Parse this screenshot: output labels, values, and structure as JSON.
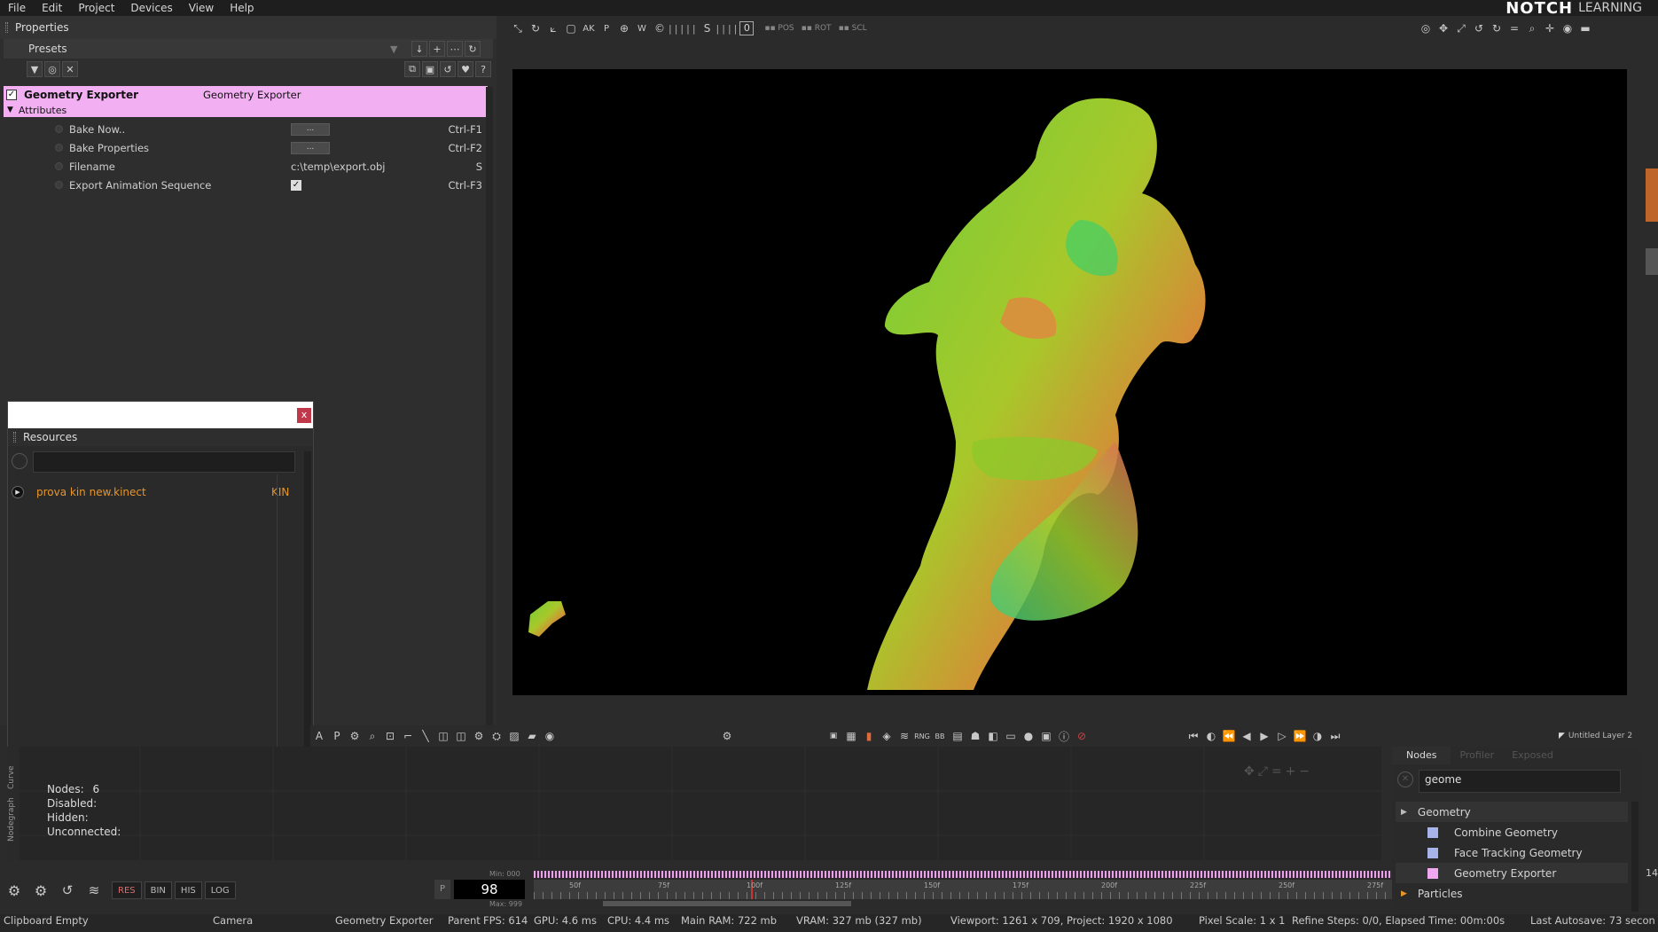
{
  "menu": [
    "File",
    "Edit",
    "Project",
    "Devices",
    "View",
    "Help"
  ],
  "brand": {
    "name": "NOTCH",
    "suffix": "LEARNING"
  },
  "properties": {
    "title": "Properties",
    "presets_label": "Presets",
    "node_name": "Geometry Exporter",
    "node_type": "Geometry Exporter",
    "section": "Attributes",
    "rows": [
      {
        "label": "Bake Now..",
        "value": "...",
        "shortcut": "Ctrl-F1"
      },
      {
        "label": "Bake Properties",
        "value": "...",
        "shortcut": "Ctrl-F2"
      },
      {
        "label": "Filename",
        "value": "c:\\temp\\export.obj",
        "shortcut": "S"
      },
      {
        "label": "Export Animation Sequence",
        "value": "✓",
        "shortcut": "Ctrl-F3"
      }
    ]
  },
  "resources": {
    "title": "Resources",
    "close": "x",
    "item_name": "prova kin new.kinect",
    "item_type": "KIN"
  },
  "toolbar_top": [
    "AK",
    "P",
    "W",
    "S",
    "0"
  ],
  "nodegraph": {
    "tabs": [
      "Nodegraph",
      "Curve"
    ],
    "stats": [
      {
        "label": "Nodes:",
        "value": "6"
      },
      {
        "label": "Disabled:",
        "value": ""
      },
      {
        "label": "Hidden:",
        "value": ""
      },
      {
        "label": "Unconnected:",
        "value": ""
      }
    ]
  },
  "bottom_buttons": [
    "RES",
    "BIN",
    "HIS",
    "LOG"
  ],
  "timeline": {
    "frame": "98",
    "min": "Min: 000",
    "max": "Max: 999",
    "ticks": [
      "50f",
      "75f",
      "100f",
      "125f",
      "150f",
      "175f",
      "200f",
      "225f",
      "250f",
      "275f"
    ],
    "layer": "Untitled Layer 2",
    "p_label": "P"
  },
  "nodes_panel": {
    "tabs": [
      "Nodes",
      "Profiler",
      "Exposed",
      "Exposed"
    ],
    "search": "geome",
    "items": [
      {
        "label": "Geometry",
        "color": "",
        "category": true
      },
      {
        "label": "Combine Geometry",
        "color": "#a8b4e8",
        "category": false
      },
      {
        "label": "Face Tracking Geometry",
        "color": "#a8b4e8",
        "category": false
      },
      {
        "label": "Geometry Exporter",
        "color": "#f0a8f0",
        "category": false
      },
      {
        "label": "Particles",
        "color": "",
        "category": true
      }
    ]
  },
  "status": {
    "clipboard": "Clipboard Empty",
    "camera": "Camera",
    "node": "Geometry Exporter",
    "parent": "Parent",
    "fps": "FPS: 614",
    "gpu": "GPU: 4.6 ms",
    "cpu": "CPU: 4.4 ms",
    "ram": "Main RAM: 722 mb",
    "vram": "VRAM: 327 mb (327 mb)",
    "viewport": "Viewport: 1261 x 709, Project: 1920 x 1080",
    "pixel": "Pixel Scale: 1 x 1",
    "refine": "Refine Steps: 0/0, Elapsed Time: 00m:00s",
    "autosave": "Last Autosave: 73 secon"
  },
  "edge_number": "14"
}
